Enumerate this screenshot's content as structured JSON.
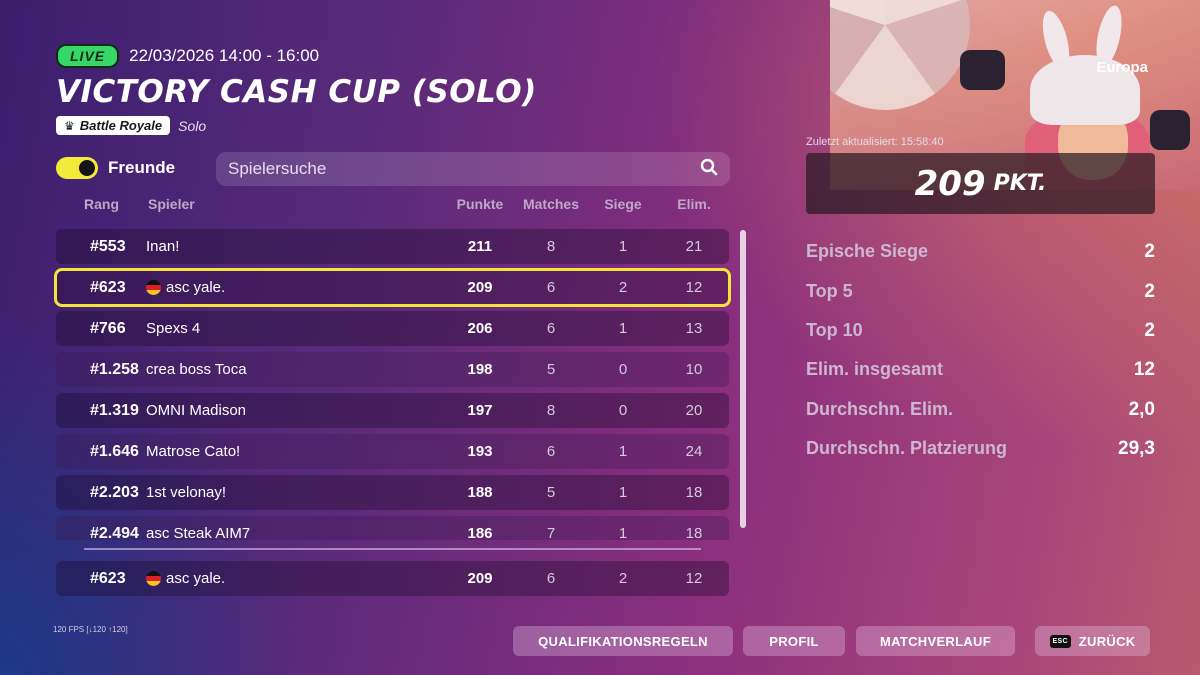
{
  "event": {
    "live_label": "LIVE",
    "date": "22/03/2026 14:00 - 16:00",
    "title": "VICTORY CASH CUP (SOLO)",
    "mode": "Battle Royale",
    "submode": "Solo"
  },
  "filters": {
    "friends_label": "Freunde",
    "friends_on": true,
    "search_placeholder": "Spielersuche"
  },
  "table": {
    "headers": {
      "rank": "Rang",
      "player": "Spieler",
      "points": "Punkte",
      "matches": "Matches",
      "wins": "Siege",
      "elims": "Elim."
    },
    "rows": [
      {
        "rank": "#553",
        "player": "Inan!",
        "points": "211",
        "matches": "8",
        "wins": "1",
        "elims": "21",
        "flag": false,
        "highlight": false
      },
      {
        "rank": "#623",
        "player": "asc yale.",
        "points": "209",
        "matches": "6",
        "wins": "2",
        "elims": "12",
        "flag": true,
        "highlight": true
      },
      {
        "rank": "#766",
        "player": "Spexs 4",
        "points": "206",
        "matches": "6",
        "wins": "1",
        "elims": "13",
        "flag": false,
        "highlight": false
      },
      {
        "rank": "#1.258",
        "player": "crea boss Toca",
        "points": "198",
        "matches": "5",
        "wins": "0",
        "elims": "10",
        "flag": false,
        "highlight": false
      },
      {
        "rank": "#1.319",
        "player": "OMNI Madison",
        "points": "197",
        "matches": "8",
        "wins": "0",
        "elims": "20",
        "flag": false,
        "highlight": false
      },
      {
        "rank": "#1.646",
        "player": "Matrose Cato!",
        "points": "193",
        "matches": "6",
        "wins": "1",
        "elims": "24",
        "flag": false,
        "highlight": false
      },
      {
        "rank": "#2.203",
        "player": "1st velonay!",
        "points": "188",
        "matches": "5",
        "wins": "1",
        "elims": "18",
        "flag": false,
        "highlight": false
      },
      {
        "rank": "#2.494",
        "player": "asc Steak AIM7",
        "points": "186",
        "matches": "7",
        "wins": "1",
        "elims": "18",
        "flag": false,
        "highlight": false
      }
    ],
    "pinned": {
      "rank": "#623",
      "player": "asc yale.",
      "points": "209",
      "matches": "6",
      "wins": "2",
      "elims": "12",
      "flag": true
    }
  },
  "stats": {
    "region": "Europa",
    "updated": "Zuletzt aktualisiert: 15:58:40",
    "points_value": "209",
    "points_unit": "PKT.",
    "items": [
      {
        "label": "Epische Siege",
        "value": "2"
      },
      {
        "label": "Top 5",
        "value": "2"
      },
      {
        "label": "Top 10",
        "value": "2"
      },
      {
        "label": "Elim. insgesamt",
        "value": "12"
      },
      {
        "label": "Durchschn. Elim.",
        "value": "2,0"
      },
      {
        "label": "Durchschn. Platzierung",
        "value": "29,3"
      }
    ]
  },
  "footer": {
    "fps": "120 FPS [↓120 ↑120]",
    "buttons": {
      "rules": "QUALIFIKATIONSREGELN",
      "profile": "PROFIL",
      "history": "MATCHVERLAUF",
      "back": "ZURÜCK",
      "esc_key": "ESC"
    }
  },
  "colors": {
    "live": "#35d868",
    "highlight": "#f3e33d",
    "toggle": "#f2ea3a"
  }
}
